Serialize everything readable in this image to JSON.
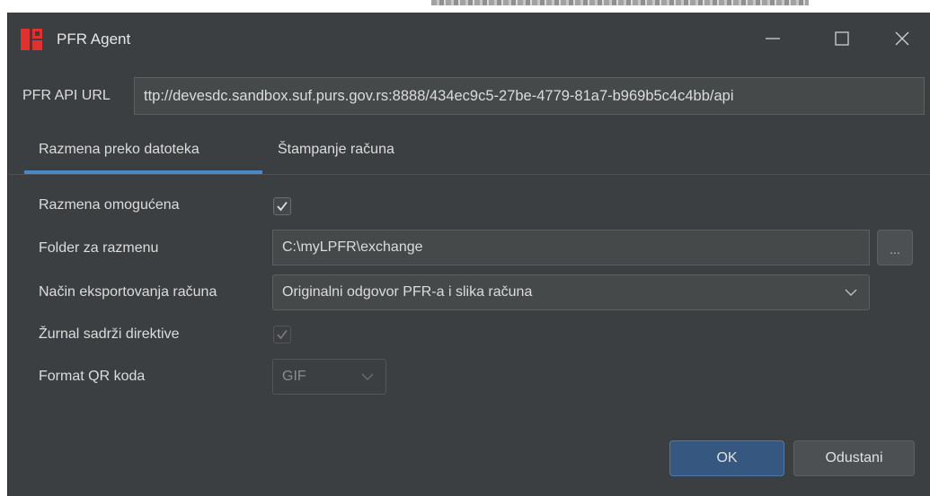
{
  "window": {
    "title": "PFR Agent"
  },
  "api": {
    "label": "PFR API URL",
    "value": "ttp://devesdc.sandbox.suf.purs.gov.rs:8888/434ec9c5-27be-4779-81a7-b969b5c4c4bb/api"
  },
  "tabs": [
    {
      "label": "Razmena preko datoteka",
      "selected": true
    },
    {
      "label": "Štampanje računa",
      "selected": false
    }
  ],
  "form": {
    "exchange_enabled": {
      "label": "Razmena omogućena",
      "checked": true
    },
    "folder": {
      "label": "Folder za razmenu",
      "value": "C:\\myLPFR\\exchange",
      "browse_label": "..."
    },
    "export_mode": {
      "label": "Način eksportovanja računa",
      "value": "Originalni odgovor PFR-a i slika računa"
    },
    "journal_directives": {
      "label": "Žurnal sadrži direktive",
      "checked": true,
      "disabled": true
    },
    "qr_format": {
      "label": "Format QR koda",
      "value": "GIF",
      "disabled": true
    }
  },
  "buttons": {
    "ok": "OK",
    "cancel": "Odustani"
  },
  "colors": {
    "background": "#3c3f41",
    "accent": "#4a88c7",
    "primary_button": "#365880"
  }
}
